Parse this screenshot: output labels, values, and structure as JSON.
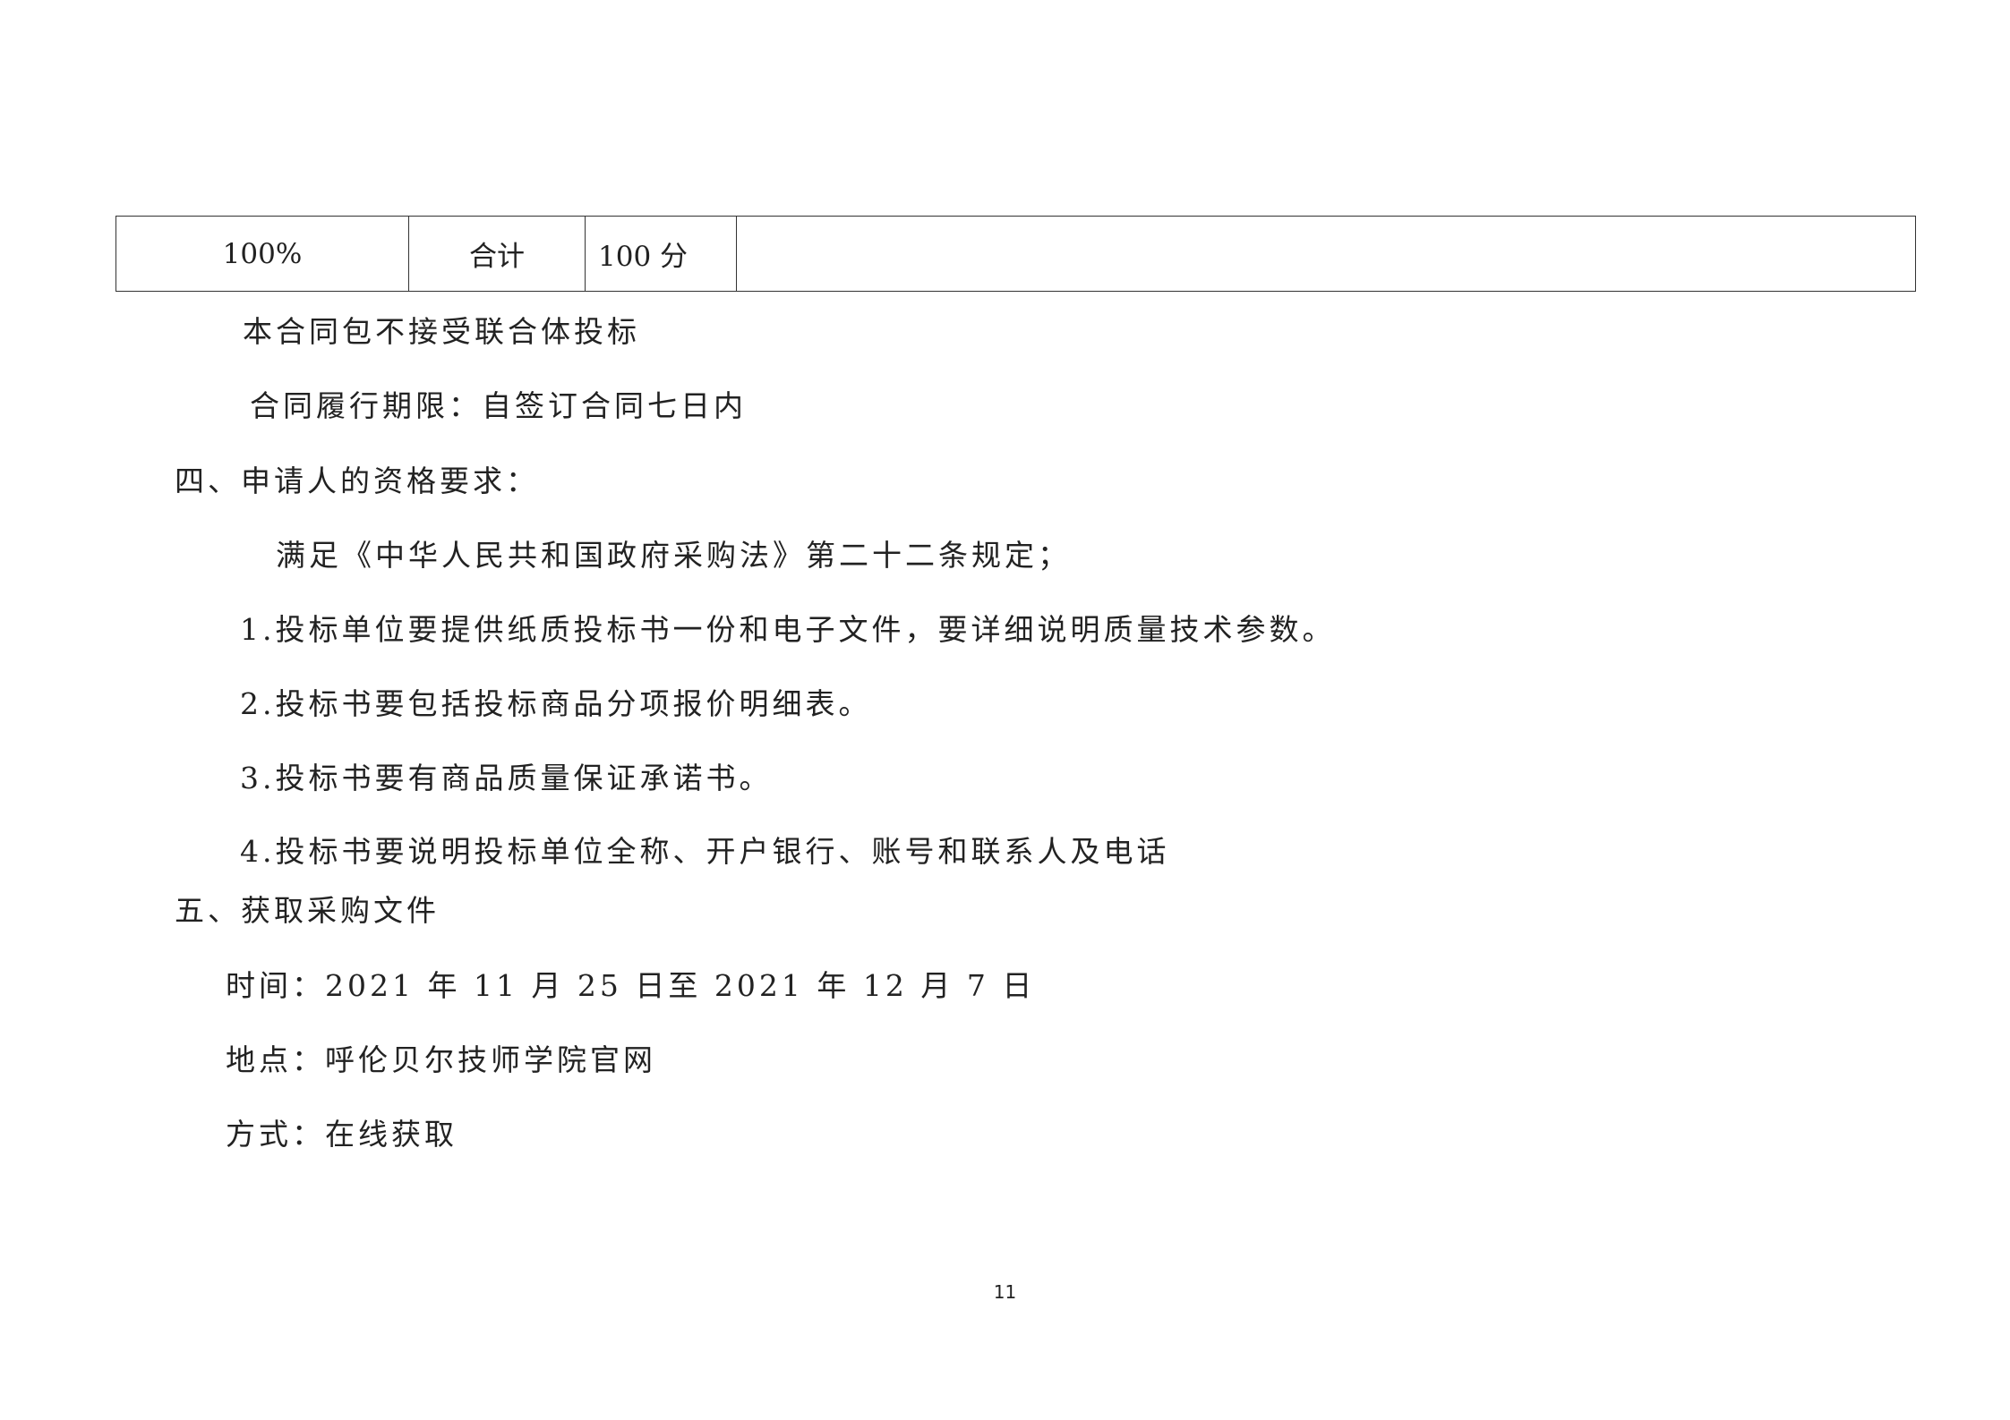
{
  "table": {
    "row": {
      "weight": "100%",
      "label": "合计",
      "score": "100 分",
      "note": ""
    }
  },
  "body": {
    "no_consortium": "本合同包不接受联合体投标",
    "performance_period": "合同履行期限：自签订合同七日内",
    "section4_heading": "四、申请人的资格要求：",
    "law_requirement": "满足《中华人民共和国政府采购法》第二十二条规定；",
    "req_1": "1.投标单位要提供纸质投标书一份和电子文件，要详细说明质量技术参数。",
    "req_2": "2.投标书要包括投标商品分项报价明细表。",
    "req_3": "3.投标书要有商品质量保证承诺书。",
    "req_4": "4.投标书要说明投标单位全称、开户银行、账号和联系人及电话",
    "section5_heading": "五、获取采购文件",
    "time": "时间：2021 年 11 月 25 日至 2021 年 12 月 7 日",
    "place": "地点：呼伦贝尔技师学院官网",
    "method": "方式：在线获取"
  },
  "footer": {
    "page_number": "11"
  }
}
